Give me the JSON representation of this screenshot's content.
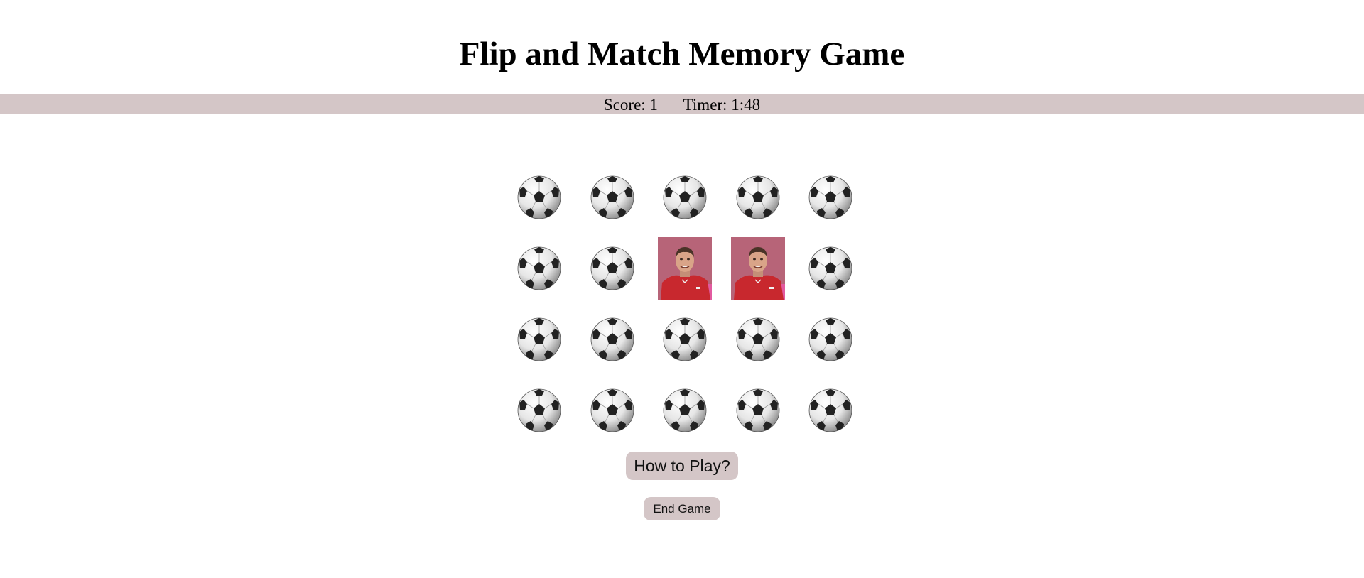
{
  "title": "Flip and Match Memory Game",
  "status": {
    "score_text": "Score: 1",
    "timer_text": "Timer: 1:48"
  },
  "board": {
    "rows": 4,
    "columns": 5,
    "cards": [
      {
        "state": "face-down",
        "icon": "soccer-ball-icon"
      },
      {
        "state": "face-down",
        "icon": "soccer-ball-icon"
      },
      {
        "state": "face-down",
        "icon": "soccer-ball-icon"
      },
      {
        "state": "face-down",
        "icon": "soccer-ball-icon"
      },
      {
        "state": "face-down",
        "icon": "soccer-ball-icon"
      },
      {
        "state": "face-down",
        "icon": "soccer-ball-icon"
      },
      {
        "state": "face-down",
        "icon": "soccer-ball-icon"
      },
      {
        "state": "matched",
        "icon": "player-photo-icon"
      },
      {
        "state": "matched",
        "icon": "player-photo-icon"
      },
      {
        "state": "face-down",
        "icon": "soccer-ball-icon"
      },
      {
        "state": "face-down",
        "icon": "soccer-ball-icon"
      },
      {
        "state": "face-down",
        "icon": "soccer-ball-icon"
      },
      {
        "state": "face-down",
        "icon": "soccer-ball-icon"
      },
      {
        "state": "face-down",
        "icon": "soccer-ball-icon"
      },
      {
        "state": "face-down",
        "icon": "soccer-ball-icon"
      },
      {
        "state": "face-down",
        "icon": "soccer-ball-icon"
      },
      {
        "state": "face-down",
        "icon": "soccer-ball-icon"
      },
      {
        "state": "face-down",
        "icon": "soccer-ball-icon"
      },
      {
        "state": "face-down",
        "icon": "soccer-ball-icon"
      },
      {
        "state": "face-down",
        "icon": "soccer-ball-icon"
      }
    ]
  },
  "buttons": {
    "how_to_play": "How to Play?",
    "end_game": "End Game"
  },
  "colors": {
    "status_bar_bg": "#d4c6c7",
    "button_bg": "#d4c6c7",
    "photo_bg": "#b76478",
    "jersey": "#c8282e"
  }
}
